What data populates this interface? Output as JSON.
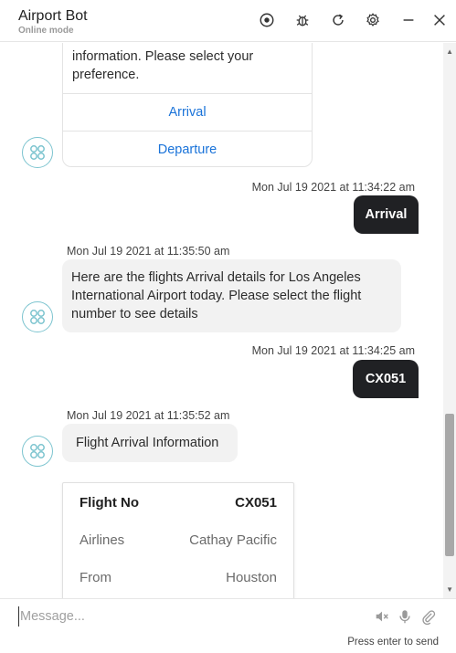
{
  "header": {
    "title": "Airport Bot",
    "subtitle": "Online mode",
    "icons": [
      "record-icon",
      "bug-icon",
      "refresh-icon",
      "settings-icon",
      "minimize-icon",
      "close-icon"
    ]
  },
  "messages": {
    "options_card": {
      "partial_text_line1": "information. Please select your",
      "partial_text_line2": "preference.",
      "options": [
        "Arrival",
        "Departure"
      ]
    },
    "user1": {
      "timestamp": "Mon Jul 19 2021 at 11:34:22 am",
      "text": "Arrival"
    },
    "bot2": {
      "timestamp": "Mon Jul 19 2021 at 11:35:50 am",
      "line1": "Here are the flights Arrival details for Los Angeles",
      "line2": "International Airport today. Please select the flight",
      "line3": "number to see details"
    },
    "user2": {
      "timestamp": "Mon Jul 19 2021 at 11:34:25 am",
      "text": "CX051"
    },
    "bot3": {
      "timestamp": "Mon Jul 19 2021 at 11:35:52 am",
      "text": "Flight Arrival Information"
    },
    "flight_card": {
      "head_key": "Flight No",
      "head_value": "CX051",
      "rows": [
        {
          "key": "Airlines",
          "value": "Cathay Pacific"
        },
        {
          "key": "From",
          "value": "Houston"
        }
      ]
    }
  },
  "composer": {
    "placeholder": "Message...",
    "hint": "Press enter to send",
    "icons": [
      "speaker-muted-icon",
      "microphone-icon",
      "attachment-icon"
    ]
  },
  "colors": {
    "accent": "#1a73d9",
    "avatar_ring": "#7cc4cf",
    "user_bubble": "#202124",
    "bot_bubble": "#f2f2f2"
  }
}
